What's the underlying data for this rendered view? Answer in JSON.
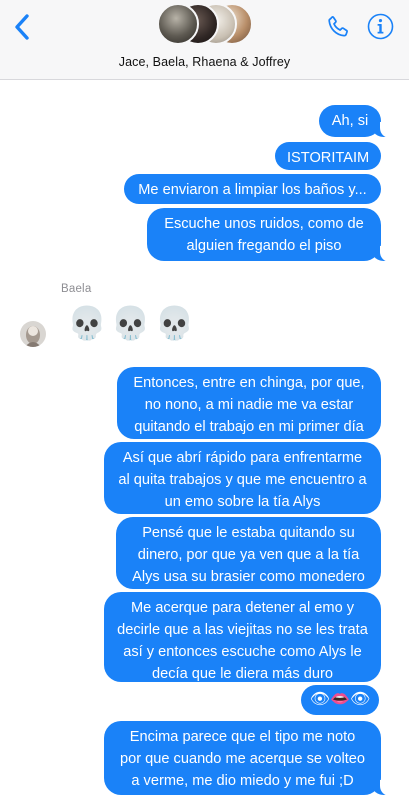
{
  "header": {
    "title": "Jace, Baela, Rhaena & Joffrey",
    "back_icon": "chevron-left-icon",
    "call_icon": "phone-icon",
    "info_icon": "info-icon",
    "accent_color": "#1a82f8"
  },
  "group_avatars": [
    "avatar-1",
    "avatar-2",
    "avatar-3",
    "avatar-4"
  ],
  "messages": [
    {
      "from": "me",
      "text": "Ah, si"
    },
    {
      "from": "me",
      "text": "ISTORITAIM"
    },
    {
      "from": "me",
      "text": "Me enviaron a limpiar los baños y..."
    },
    {
      "from": "me",
      "text": "Escuche unos ruidos, como de\nalguien fregando el piso"
    },
    {
      "from": "Baela",
      "sender_label": "Baela",
      "text": "💀💀💀"
    },
    {
      "from": "me",
      "text": "Entonces, entre en chinga, por que,\nno nono, a mi nadie me va estar\nquitando el trabajo en mi primer día"
    },
    {
      "from": "me",
      "text": "Así que abrí rápido para enfrentarme\nal quita trabajos y que me encuentro a\nun emo sobre la tía Alys"
    },
    {
      "from": "me",
      "text": "Pensé que le estaba quitando su\ndinero, por que ya ven que a la tía\nAlys usa su brasier como monedero"
    },
    {
      "from": "me",
      "text": "Me acerque para detener al emo y\ndecirle que a las viejitas no se les trata\nasí y entonces escuche como Alys le\ndecía que le diera más duro"
    },
    {
      "from": "me",
      "text": "👁👄👁"
    },
    {
      "from": "me",
      "text": "Encima parece que el tipo me noto\npor que cuando me acerque se volteo\na verme, me dio miedo y me fui ;D"
    }
  ]
}
